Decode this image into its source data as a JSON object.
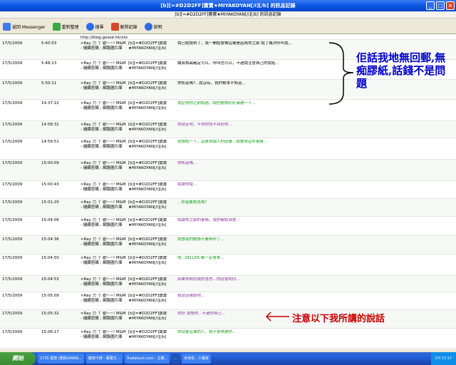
{
  "window": {
    "title": "[b][=#D2D2FF]寶寶★MIYAKOYAN[/i][/b] 的訊息記錄",
    "subtitle": "[b][=#D2D2FF]寶寶★MIYAKOYAN[/i][/b] 的訊息記錄"
  },
  "toolbar": {
    "back_label": "返回 Messenger",
    "refresh_label": "重新整理",
    "search_label": "搜尋",
    "delete_label": "刪除記錄",
    "help_label": "說明"
  },
  "rows": [
    {
      "date": "",
      "time": "",
      "user": "http://blog.gooxe.hk/xto",
      "to": "",
      "msg": "",
      "color": "black"
    },
    {
      "date": "17/5/2009",
      "time": "5:40:03",
      "user": "∞Ray 力 丫 歡~~! M&M - 儲藏密碼 ; 網路圖片庫",
      "to": "[b][=#D2D2FF]寶寶★MIYAKOYAN[/i][/b]",
      "msg": "我已經說明了，我一開始會做這樣是因為你之前 說了幾次呼叫我...",
      "color": "black"
    },
    {
      "date": "17/5/2009",
      "time": "5:48:13",
      "user": "∞Ray 力 丫 歡~~! M&M - 儲藏密碼 ; 網路圖片庫",
      "to": "[b][=#D2D2FF]寶寶★MIYAKOYAN[/i][/b]",
      "msg": "論真相需確定可以，呼叫也可以，不過請注意自己的說話...",
      "color": "black"
    },
    {
      "date": "17/5/2009",
      "time": "5:50:11",
      "user": "∞Ray 力 丫 歡~~! M&M - 儲藏密碼 ; 網路圖片庫",
      "to": "[b][=#D2D2FF]寶寶★MIYAKOYAN[/i][/b]",
      "msg": "你知道嗎?...我沒有，我們根本不知道...",
      "color": "black"
    },
    {
      "date": "17/5/2009",
      "time": "14:37:12",
      "user": "∞Ray 力 丫 歡~~! M&M - 儲藏密碼 ; 網路圖片庫",
      "to": "[b][=#D2D2FF]寶寶★MIYAKOYAN[/i][/b]",
      "msg": "我記得你之前說過...我們應該好好溝通一下...",
      "color": "green"
    },
    {
      "date": "17/5/2009",
      "time": "14:58:31",
      "user": "∞Ray 力 丫 歡~~! M&M - 儲藏密碼 ; 網路圖片庫",
      "to": "[b][=#D2D2FF]寶寶★MIYAKOYAN[/i][/b]",
      "msg": "你就走吧，不然你找不到好的...",
      "color": "purple"
    },
    {
      "date": "17/5/2009",
      "time": "14:59:51",
      "user": "∞Ray 力 丫 歡~~! M&M - 儲藏密碼 ; 網路圖片庫",
      "to": "[b][=#D2D2FF]寶寶★MIYAKOYAN[/i][/b]",
      "msg": "我想說一下，這是我個人的感覺...我覺得這件事情...",
      "color": "green"
    },
    {
      "date": "17/5/2009",
      "time": "15:00:09",
      "user": "∞Ray 力 丫 歡~~! M&M - 儲藏密碼 ; 網路圖片庫",
      "to": "[b][=#D2D2FF]寶寶★MIYAKOYAN[/i][/b]",
      "msg": "你知道嗎...",
      "color": "purple"
    },
    {
      "date": "17/5/2009",
      "time": "15:00:43",
      "user": "∞Ray 力 丫 歡~~! M&M - 儲藏密碼 ; 網路圖片庫",
      "to": "[b][=#D2D2FF]寶寶★MIYAKOYAN[/i][/b]",
      "msg": "我跟你說...",
      "color": "purple"
    },
    {
      "date": "17/5/2009",
      "time": "15:01:20",
      "user": "∞Ray 力 丫 歡~~! M&M - 儲藏密碼 ; 網路圖片庫",
      "to": "[b][=#D2D2FF]寶寶★MIYAKOYAN[/i][/b]",
      "msg": "...你還要罵我嗎?",
      "color": "green"
    },
    {
      "date": "17/5/2009",
      "time": "15:04:06",
      "user": "∞Ray 力 丫 歡~~! M&M - 儲藏密碼 ; 網路圖片庫",
      "to": "[b][=#D2D2FF]寶寶★MIYAKOYAN[/i][/b]",
      "msg": "我跟你之前的事情，我們都說清楚...",
      "color": "purple"
    },
    {
      "date": "17/5/2009",
      "time": "15:04:36",
      "user": "∞Ray 力 丫 歡~~! M&M - 儲藏密碼 ; 網路圖片庫",
      "to": "[b][=#D2D2FF]寶寶★MIYAKOYAN[/i][/b]",
      "msg": "我想我們應該不要再吵了...",
      "color": "green"
    },
    {
      "date": "17/5/2009",
      "time": "15:04:50",
      "user": "∞Ray 力 丫 歡~~! M&M - 儲藏密碼 ; 網路圖片庫",
      "to": "[b][=#D2D2FF]寶寶★MIYAKOYAN[/i][/b]",
      "msg": "唔...SELLER 都一定會罵...",
      "color": "green"
    },
    {
      "date": "17/5/2009",
      "time": "15:04:53",
      "user": "∞Ray 力 丫 歡~~! M&M - 儲藏密碼 ; 網路圖片庫",
      "to": "[b][=#D2D2FF]寶寶★MIYAKOYAN[/i][/b]",
      "msg": "如果你明白我的意思...你就會明白...",
      "color": "purple"
    },
    {
      "date": "17/5/2009",
      "time": "15:05:09",
      "user": "∞Ray 力 丫 歡~~! M&M - 儲藏密碼 ; 網路圖片庫",
      "to": "[b][=#D2D2FF]寶寶★MIYAKOYAN[/i][/b]",
      "msg": "我就這樣說吧...",
      "color": "purple"
    },
    {
      "date": "17/5/2009",
      "time": "15:05:32",
      "user": "∞Ray 力 丫 歡~~! M&M - 儲藏密碼 ; 網路圖片庫",
      "to": "[b][=#D2D2FF]寶寶★MIYAKOYAN[/i][/b]",
      "msg": "你好 我想你...不過你自己...",
      "color": "purple"
    },
    {
      "date": "17/5/2009",
      "time": "15:06:17",
      "user": "∞Ray 力 丫 歡~~! M&M - 儲藏密碼 ; 網路圖片庫",
      "to": "[b][=#D2D2FF]寶寶★MIYAKOYAN[/i][/b]",
      "msg": "你就是這樣的人，我不會再理你...",
      "color": "green"
    }
  ],
  "annotations": {
    "note1": "佢話我地無回郵,無痴膠紙,話錢不是問題",
    "note2": "注意以下我所講的說話"
  },
  "taskbar": {
    "start_label": "開始",
    "tasks": [
      "1735 匯款 (刪除)ANNA...",
      "寵物卡牌 - 寶寶方...",
      "Tradeduck.com - 主機...",
      "...",
      "未命名 - 小畫家"
    ],
    "tray": "CH 17:17"
  }
}
